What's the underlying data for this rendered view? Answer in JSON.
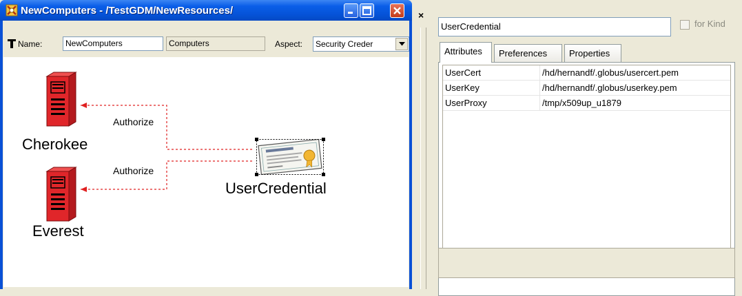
{
  "window": {
    "title": "NewComputers - /TestGDM/NewResources/",
    "name_label": "Name:",
    "name_value": "NewComputers",
    "kind_value": "Computers",
    "aspect_label": "Aspect:",
    "aspect_value": "Security Creder"
  },
  "diagram": {
    "nodes": [
      {
        "label": "Cherokee",
        "icon": "server-icon"
      },
      {
        "label": "Everest",
        "icon": "server-icon"
      },
      {
        "label": "UserCredential",
        "icon": "certificate-icon"
      }
    ],
    "edges": [
      {
        "label": "Authorize"
      },
      {
        "label": "Authorize"
      }
    ],
    "edge_color": "#e02020",
    "server_color": "#e0262a"
  },
  "panel": {
    "close_glyph": "×",
    "object_name": "UserCredential",
    "for_kind_label": "for Kind",
    "tabs": [
      "Attributes",
      "Preferences",
      "Properties"
    ],
    "attributes": [
      {
        "key": "UserCert",
        "value": "/hd/hernandf/.globus/usercert.pem"
      },
      {
        "key": "UserKey",
        "value": "/hd/hernandf/.globus/userkey.pem"
      },
      {
        "key": "UserProxy",
        "value": "/tmp/x509up_u1879"
      }
    ]
  }
}
